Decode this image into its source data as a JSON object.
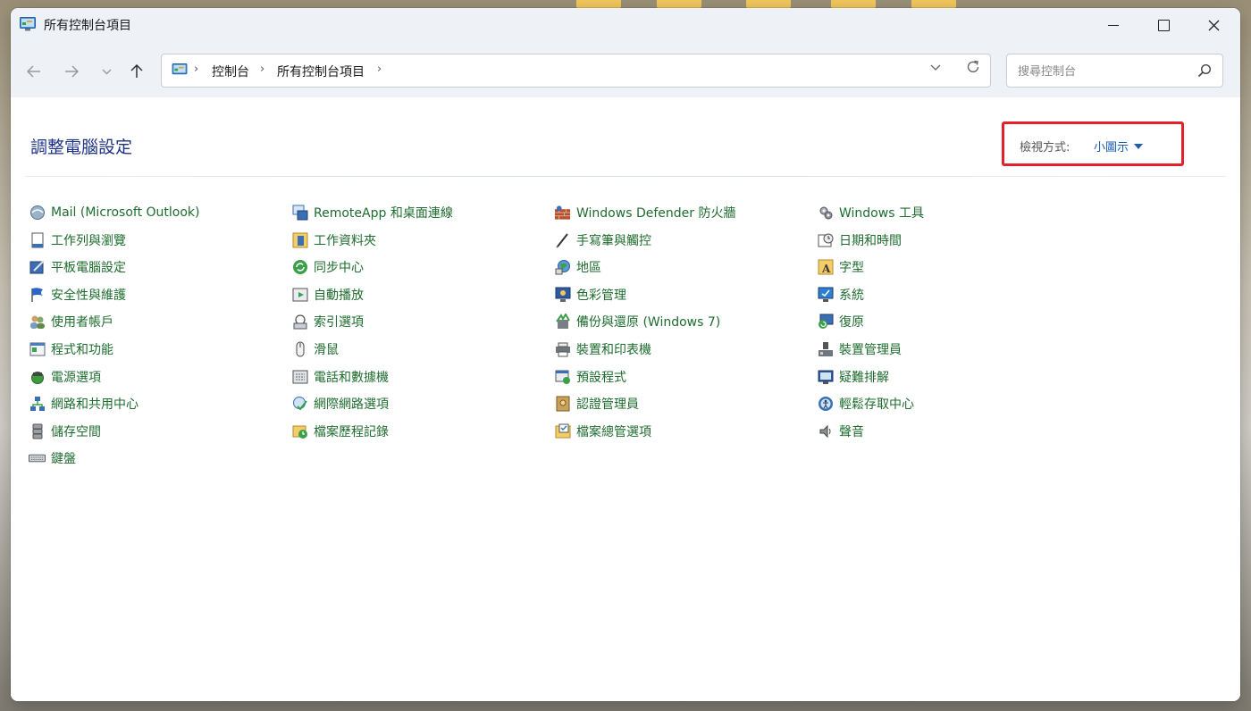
{
  "window": {
    "title": "所有控制台項目"
  },
  "navigation": {
    "breadcrumbs": [
      "控制台",
      "所有控制台項目"
    ],
    "search_placeholder": "搜尋控制台"
  },
  "main": {
    "heading": "調整電腦設定",
    "view_by_label": "檢視方式:",
    "view_by_value": "小圖示"
  },
  "items": {
    "col1": [
      {
        "label": "Mail (Microsoft Outlook)",
        "icon": "mail-icon"
      },
      {
        "label": "工作列與瀏覽",
        "icon": "taskbar-icon"
      },
      {
        "label": "平板電腦設定",
        "icon": "tablet-settings-icon"
      },
      {
        "label": "安全性與維護",
        "icon": "flag-icon"
      },
      {
        "label": "使用者帳戶",
        "icon": "users-icon"
      },
      {
        "label": "程式和功能",
        "icon": "programs-icon"
      },
      {
        "label": "電源選項",
        "icon": "power-icon"
      },
      {
        "label": "網路和共用中心",
        "icon": "network-icon"
      },
      {
        "label": "儲存空間",
        "icon": "storage-icon"
      },
      {
        "label": "鍵盤",
        "icon": "keyboard-icon"
      }
    ],
    "col2": [
      {
        "label": "RemoteApp 和桌面連線",
        "icon": "remoteapp-icon"
      },
      {
        "label": "工作資料夾",
        "icon": "work-folders-icon"
      },
      {
        "label": "同步中心",
        "icon": "sync-icon"
      },
      {
        "label": "自動播放",
        "icon": "autoplay-icon"
      },
      {
        "label": "索引選項",
        "icon": "indexing-icon"
      },
      {
        "label": "滑鼠",
        "icon": "mouse-icon"
      },
      {
        "label": "電話和數據機",
        "icon": "phone-modem-icon"
      },
      {
        "label": "網際網路選項",
        "icon": "internet-options-icon"
      },
      {
        "label": "檔案歷程記錄",
        "icon": "file-history-icon"
      }
    ],
    "col3": [
      {
        "label": "Windows Defender 防火牆",
        "icon": "firewall-icon"
      },
      {
        "label": "手寫筆與觸控",
        "icon": "pen-icon"
      },
      {
        "label": "地區",
        "icon": "region-icon"
      },
      {
        "label": "色彩管理",
        "icon": "color-management-icon"
      },
      {
        "label": "備份與還原 (Windows 7)",
        "icon": "backup-icon"
      },
      {
        "label": "裝置和印表機",
        "icon": "printer-icon"
      },
      {
        "label": "預設程式",
        "icon": "default-programs-icon"
      },
      {
        "label": "認證管理員",
        "icon": "credential-icon"
      },
      {
        "label": "檔案總管選項",
        "icon": "explorer-options-icon"
      }
    ],
    "col4": [
      {
        "label": "Windows 工具",
        "icon": "windows-tools-icon"
      },
      {
        "label": "日期和時間",
        "icon": "date-time-icon"
      },
      {
        "label": "字型",
        "icon": "font-icon"
      },
      {
        "label": "系統",
        "icon": "system-icon"
      },
      {
        "label": "復原",
        "icon": "recovery-icon"
      },
      {
        "label": "裝置管理員",
        "icon": "device-manager-icon"
      },
      {
        "label": "疑難排解",
        "icon": "troubleshoot-icon"
      },
      {
        "label": "輕鬆存取中心",
        "icon": "ease-of-access-icon"
      },
      {
        "label": "聲音",
        "icon": "speaker-icon"
      }
    ]
  },
  "colors": {
    "link_green": "#1e6c2e",
    "heading_blue": "#1e3287",
    "highlight_red": "#e4202b",
    "titlebar_bg": "#eef2f7"
  }
}
